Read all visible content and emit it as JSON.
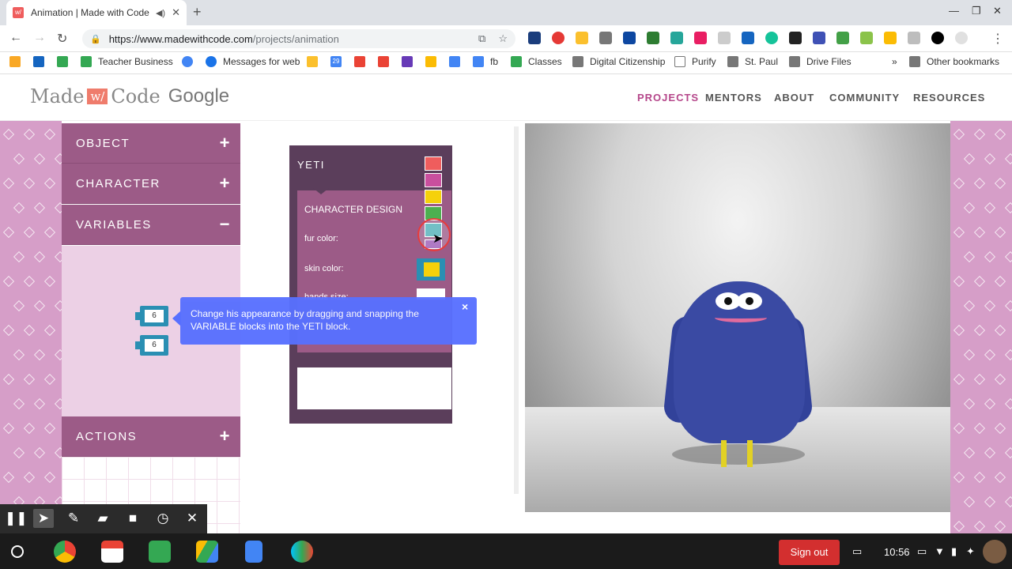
{
  "browser": {
    "tab_title": "Animation | Made with Code",
    "tab_favicon": "w/",
    "url_host": "https://www.madewithcode.com",
    "url_path": "/projects/animation",
    "bookmarks": [
      "Teacher Business",
      "Messages for web",
      "fb",
      "Classes",
      "Digital Citizenship",
      "Purify",
      "St. Paul",
      "Drive Files",
      "Other bookmarks"
    ],
    "bookmark_badge_29": "29"
  },
  "site": {
    "logo_made": "Made",
    "logo_w": "w/",
    "logo_code": "Code",
    "logo_google": "Google",
    "nav": [
      "PROJECTS",
      "MENTORS",
      "ABOUT",
      "COMMUNITY",
      "RESOURCES"
    ],
    "active_nav": "PROJECTS"
  },
  "palette": {
    "categories": [
      {
        "label": "OBJECT",
        "symbol": "+"
      },
      {
        "label": "CHARACTER",
        "symbol": "+"
      },
      {
        "label": "VARIABLES",
        "symbol": "−"
      },
      {
        "label": "ACTIONS",
        "symbol": "+"
      }
    ],
    "variable_blocks": [
      "6",
      "6"
    ]
  },
  "workspace": {
    "yeti_label": "YETI",
    "design_title": "CHARACTER DESIGN",
    "fields": [
      "fur color:",
      "skin color:",
      "hands size:"
    ],
    "swatch_colors": [
      "#ef5d5d",
      "#c94f9e",
      "#f5d10b",
      "#4caf50",
      "#4fb0b8",
      "#9b59b6"
    ],
    "skin_color": "#f5d10b"
  },
  "tooltip": {
    "text": "Change his appearance by dragging and snapping the VARIABLE blocks into the YETI block.",
    "close": "×"
  },
  "taskbar": {
    "sign_out": "Sign out",
    "time": "10:56"
  },
  "colors": {
    "accent": "#b5468a",
    "category_bg": "#9c5b87",
    "yeti_block": "#5b3e5b",
    "tooltip": "#5870ff",
    "yeti_fur": "#3a4aa3"
  }
}
